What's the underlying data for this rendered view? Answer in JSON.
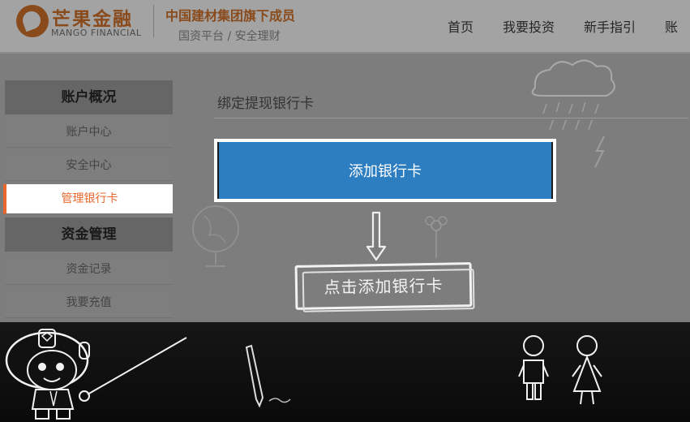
{
  "header": {
    "logo_cn": "芒果金融",
    "logo_en": "MANGO FINANCIAL",
    "slogan_main": "中国建材集团旗下成员",
    "slogan_sub": "国资平台 / 安全理财",
    "nav": [
      "首页",
      "我要投资",
      "新手指引",
      "账"
    ]
  },
  "sidebar": {
    "sections": [
      {
        "title": "账户概况",
        "items": [
          "账户中心",
          "安全中心",
          "管理银行卡"
        ]
      },
      {
        "title": "资金管理",
        "items": [
          "资金记录",
          "我要充值"
        ]
      }
    ],
    "active_item": "管理银行卡"
  },
  "main": {
    "title": "绑定提现银行卡",
    "add_card_button": "添加银行卡",
    "hint": "点击添加银行卡"
  },
  "colors": {
    "accent_orange": "#e9662c",
    "button_blue": "#2c7ec0",
    "brand_brown": "#8a4b1c"
  }
}
